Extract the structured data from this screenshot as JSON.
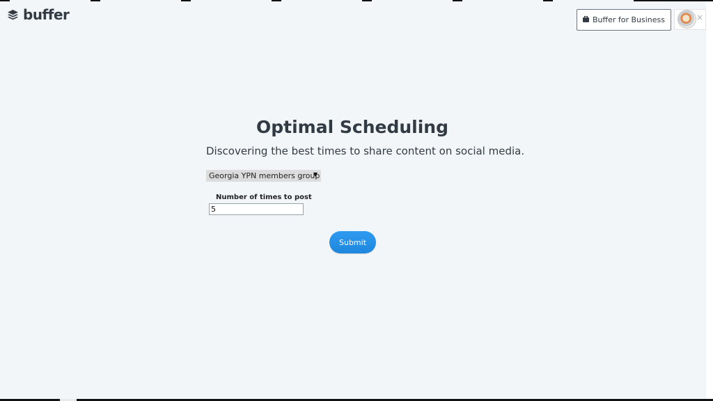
{
  "header": {
    "logo_text": "buffer",
    "business_button_label": "Buffer for Business",
    "close_glyph": "×"
  },
  "main": {
    "title": "Optimal Scheduling",
    "subtitle": "Discovering the best times to share content on social media.",
    "group_select": {
      "selected": "Georgia YPN members group",
      "arrow_glyph": "▼"
    },
    "times_field": {
      "label": "Number of times to post",
      "value": "5"
    },
    "submit_label": "Submit"
  },
  "colors": {
    "background": "#f3f6f9",
    "text": "#323b43",
    "accent": "#2f9bf0"
  },
  "icons": {
    "logo": "buffer-stack-icon",
    "business": "briefcase-icon",
    "avatar": "user-avatar",
    "close": "close-icon"
  }
}
